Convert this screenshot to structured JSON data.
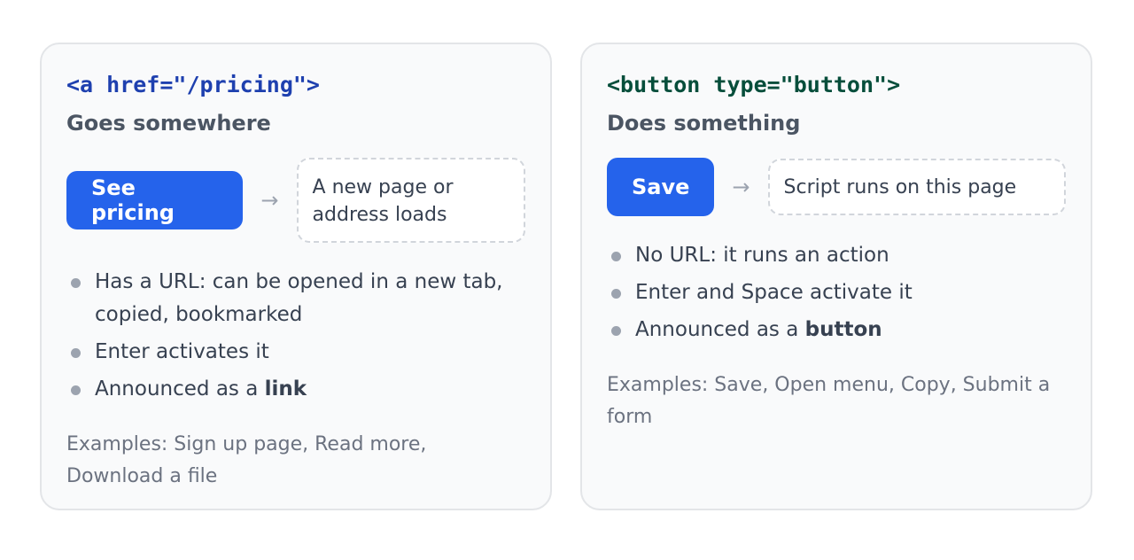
{
  "link_card": {
    "code": "<a href=\"/pricing\">",
    "subtitle": "Goes somewhere",
    "button_label": "See pricing",
    "arrow": "→",
    "result": "A new page or address loads",
    "points": [
      {
        "text": "Has a URL: can be opened in a new tab, copied, bookmarked",
        "bold": ""
      },
      {
        "text": "Enter activates it",
        "bold": ""
      },
      {
        "text": "Announced as a ",
        "bold": "link"
      }
    ],
    "examples": "Examples: Sign up page, Read more, Download a file"
  },
  "button_card": {
    "code": "<button type=\"button\">",
    "subtitle": "Does something",
    "button_label": "Save",
    "arrow": "→",
    "result": "Script runs on this page",
    "points": [
      {
        "text": "No URL: it runs an action",
        "bold": ""
      },
      {
        "text": "Enter and Space activate it",
        "bold": ""
      },
      {
        "text": "Announced as a ",
        "bold": "button"
      }
    ],
    "examples": "Examples: Save, Open menu, Copy, Submit a form"
  },
  "colors": {
    "primary": "#2563eb",
    "link_code": "#1e40af",
    "button_code": "#064e3b"
  }
}
